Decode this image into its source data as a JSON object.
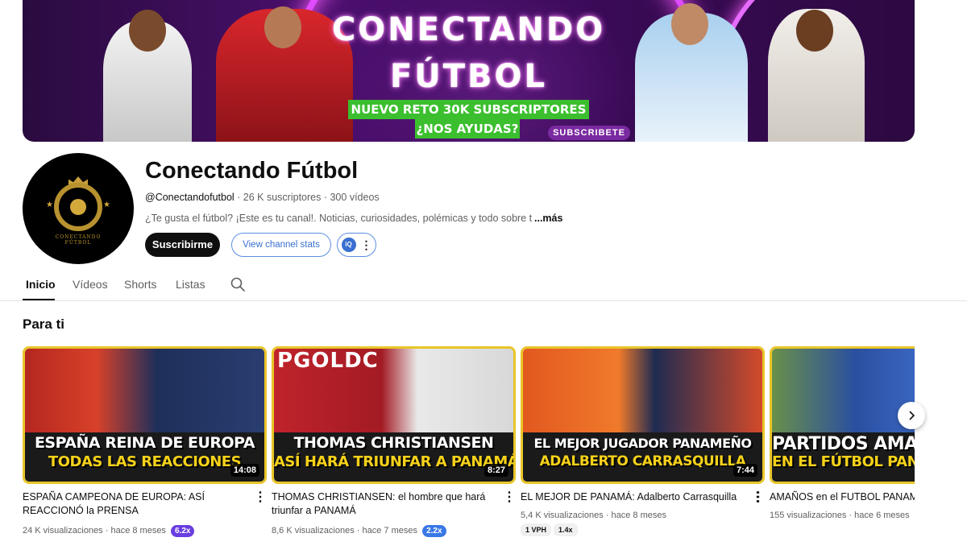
{
  "banner": {
    "title_line1": "CONECTANDO",
    "title_line2": "FÚTBOL",
    "promo_line1": "NUEVO RETO 30K SUBSCRIPTORES",
    "promo_line2": "¿NOS AYUDAS?",
    "subscribe_badge": "SUBSCRIBETE"
  },
  "channel": {
    "avatar_caption": "CONECTANDO FÚTBOL",
    "name": "Conectando Fútbol",
    "handle": "@Conectandofutbol",
    "subscribers": "26 K suscriptores",
    "videos": "300 vídeos",
    "separator": " · ",
    "description": "¿Te gusta el fútbol? ¡Este es tu canal!. Noticias, curiosidades, polémicas y todo sobre tus",
    "more_label": "...más",
    "subscribe_label": "Suscribirme",
    "stats_label": "View channel stats",
    "extension_label": "iQ"
  },
  "tabs": [
    {
      "label": "Inicio",
      "active": true
    },
    {
      "label": "Vídeos",
      "active": false
    },
    {
      "label": "Shorts",
      "active": false
    },
    {
      "label": "Listas",
      "active": false
    }
  ],
  "section": {
    "title": "Para ti"
  },
  "videos": [
    {
      "thumb_line1": "ESPAÑA REINA DE EUROPA",
      "thumb_line2": "TODAS LAS REACCIONES",
      "duration": "14:08",
      "title": "ESPAÑA CAMPEONA DE EUROPA: ASÍ REACCIONÓ la PRENSA",
      "views": "24 K visualizaciones",
      "age": "hace 8 meses",
      "badge": "6.2x",
      "badge_color": "#6a3ee0",
      "tags": []
    },
    {
      "thumb_line1": "THOMAS CHRISTIANSEN",
      "thumb_line2": "ASÍ HARÁ TRIUNFAR A PANAMÁ",
      "thumb_top": "PGOLDC",
      "duration": "8:27",
      "title": "THOMAS CHRISTIANSEN: el hombre que hará triunfar a PANAMÁ",
      "views": "8,6 K visualizaciones",
      "age": "hace 7 meses",
      "badge": "2.2x",
      "badge_color": "#3a78e6",
      "tags": []
    },
    {
      "thumb_line1": "EL MEJOR JUGADOR PANAMEÑO",
      "thumb_line2": "ADALBERTO CARRASQUILLA",
      "duration": "7:44",
      "title": "EL MEJOR DE PANAMÁ: Adalberto Carrasquilla",
      "views": "5,4 K visualizaciones",
      "age": "hace 8 meses",
      "badge": "",
      "badge_color": "",
      "tags": [
        "1 VPH",
        "1.4x"
      ]
    },
    {
      "thumb_line1": "PARTIDOS AMAÑADOS",
      "thumb_line2": "EN EL FÚTBOL PANAMEÑO",
      "duration": "",
      "title": "AMAÑOS en el FUTBOL PANAMEÑO",
      "views": "155 visualizaciones",
      "age": "hace 6 meses",
      "badge": "",
      "badge_color": "",
      "tags": []
    }
  ],
  "colors": {
    "accent_dark": "#0f0f0f",
    "secondary_text": "#606060",
    "thumb_border": "#e8c52a",
    "stats_blue": "#3a6fd1"
  },
  "icons": {
    "search": "search-icon",
    "next": "chevron-right-icon",
    "more": "more-vert-icon"
  }
}
